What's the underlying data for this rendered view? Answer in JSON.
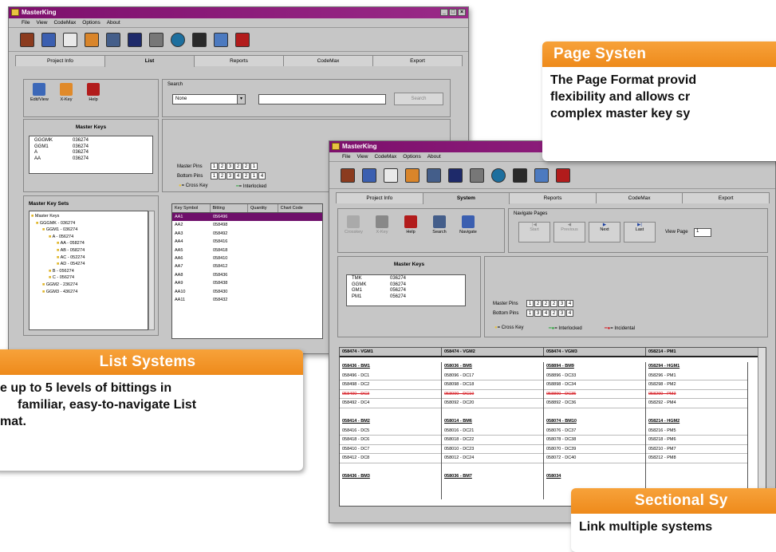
{
  "win1": {
    "title": "MasterKing",
    "menu": [
      "File",
      "View",
      "CodeMax",
      "Options",
      "About"
    ],
    "tabs": [
      "Project Info",
      "List",
      "Reports",
      "CodeMax",
      "Export"
    ],
    "active_tab": "List",
    "tools": [
      "Edit/View",
      "X-Key",
      "Help"
    ],
    "search_label": "Search",
    "search_select": "None",
    "search_button": "Search",
    "master_keys_title": "Master Keys",
    "master_keys": [
      [
        "GGGMK",
        "036274"
      ],
      [
        "GGM1",
        "036274"
      ],
      [
        "A",
        "036274"
      ],
      [
        "AA",
        "036274"
      ]
    ],
    "master_pins_label": "Master Pins",
    "master_pins": [
      "1",
      "2",
      "3",
      "2",
      "2",
      "1"
    ],
    "bottom_pins_label": "Bottom Pins",
    "bottom_pins": [
      "1",
      "2",
      "3",
      "4",
      "2",
      "1",
      "4"
    ],
    "legend": [
      "= Cross Key",
      "= Interlocked",
      "= Incidental"
    ],
    "sets_title": "Master Key Sets",
    "tree": [
      "Master Keys",
      "GGGMK - 036274",
      "GGM1 - 036274",
      "A - 056274",
      "AA - 058274",
      "AB - 058274",
      "AC - 052274",
      "AD - 054274",
      "B - 056274",
      "C - 056274",
      "GGM2 - 236274",
      "GGM3 - 436274"
    ],
    "table_headers": [
      "Key Symbol",
      "Bitting",
      "Quantity",
      "Chart Code"
    ],
    "table_rows": [
      [
        "AA1",
        "056496"
      ],
      [
        "AA2",
        "058498"
      ],
      [
        "AA3",
        "058492"
      ],
      [
        "AA4",
        "058416"
      ],
      [
        "AA5",
        "058418"
      ],
      [
        "AA6",
        "058410"
      ],
      [
        "AA7",
        "058412"
      ],
      [
        "AA8",
        "058436"
      ],
      [
        "AA9",
        "058438"
      ],
      [
        "AA10",
        "058430"
      ],
      [
        "AA11",
        "058432"
      ]
    ]
  },
  "win2": {
    "title": "MasterKing",
    "menu": [
      "File",
      "View",
      "CodeMax",
      "Options",
      "About"
    ],
    "tabs": [
      "Project Info",
      "System",
      "Reports",
      "CodeMax",
      "Export"
    ],
    "active_tab": "System",
    "tools": [
      "Crosskey",
      "X-Key",
      "Help",
      "Search",
      "Navigate"
    ],
    "nav_title": "Navigate Pages",
    "nav_buttons": [
      "Start",
      "Previous",
      "Next",
      "Last"
    ],
    "view_page_label": "View Page",
    "view_page_value": "1",
    "master_keys_title": "Master Keys",
    "master_keys": [
      [
        "TMK",
        "036274"
      ],
      [
        "GGMK",
        "036274"
      ],
      [
        "GM1",
        "056274"
      ],
      [
        "PM1",
        "056274"
      ]
    ],
    "master_pins_label": "Master Pins",
    "master_pins": [
      "1",
      "2",
      "2",
      "2",
      "3",
      "4"
    ],
    "bottom_pins_label": "Bottom Pins",
    "bottom_pins": [
      "1",
      "3",
      "4",
      "2",
      "3",
      "4"
    ],
    "legend": [
      "= Cross Key",
      "= Interlocked",
      "= Incidental"
    ],
    "grid_headers": [
      "058474 - VGM1",
      "058474 - VGM2",
      "058474 - VGM3",
      "058214 - PM1"
    ],
    "grid_cols": [
      [
        {
          "t": "058436 - BM1",
          "h": true
        },
        {
          "t": "058496 - DC1"
        },
        {
          "t": "058498 - DC2"
        },
        {
          "t": "058490 - DC3",
          "s": true
        },
        {
          "t": "058492 - DC4"
        },
        {
          "t": ""
        },
        {
          "t": "058414 - BM2",
          "h": true
        },
        {
          "t": "058416 - DC5"
        },
        {
          "t": "058418 - DC6"
        },
        {
          "t": "058410 - DC7"
        },
        {
          "t": "058412 - DC8"
        },
        {
          "t": ""
        },
        {
          "t": "058436 - BM3",
          "h": true
        }
      ],
      [
        {
          "t": "058036 - BM5",
          "h": true
        },
        {
          "t": "058096 - DC17"
        },
        {
          "t": "058098 - DC18"
        },
        {
          "t": "058090 - DC19",
          "s": true
        },
        {
          "t": "058092 - DC20"
        },
        {
          "t": ""
        },
        {
          "t": "058014 - BM6",
          "h": true
        },
        {
          "t": "058016 - DC21"
        },
        {
          "t": "058018 - DC22"
        },
        {
          "t": "058010 - DC23"
        },
        {
          "t": "058012 - DC24"
        },
        {
          "t": ""
        },
        {
          "t": "058036 - BM7",
          "h": true
        }
      ],
      [
        {
          "t": "058894 - BM9",
          "h": true
        },
        {
          "t": "058896 - DC33"
        },
        {
          "t": "058898 - DC34"
        },
        {
          "t": "058890 - DC35",
          "s": true
        },
        {
          "t": "058892 - DC36"
        },
        {
          "t": ""
        },
        {
          "t": "058074 - BM10",
          "h": true
        },
        {
          "t": "058076 - DC37"
        },
        {
          "t": "058078 - DC38"
        },
        {
          "t": "058070 - DC39"
        },
        {
          "t": "058072 - DC40"
        },
        {
          "t": ""
        },
        {
          "t": "058034",
          "h": true
        }
      ],
      [
        {
          "t": "058294 - HGM1",
          "h": true
        },
        {
          "t": "058296 - PM1"
        },
        {
          "t": "058298 - PM2"
        },
        {
          "t": "058290 - PM3",
          "s": true
        },
        {
          "t": "058292 - PM4"
        },
        {
          "t": ""
        },
        {
          "t": "058214 - HGM2",
          "h": true
        },
        {
          "t": "058216 - PM5"
        },
        {
          "t": "058218 - PM6"
        },
        {
          "t": "058210 - PM7"
        },
        {
          "t": "058212 - PM8"
        }
      ]
    ]
  },
  "callouts": {
    "page": {
      "title": "Page Systen",
      "body": [
        "The Page Format provid",
        "flexibility and allows cr",
        "complex master key sy"
      ]
    },
    "list": {
      "title": "List Systems",
      "body": [
        "e up to 5 levels of bittings in",
        "familiar, easy-to-navigate List",
        "mat."
      ]
    },
    "sectional": {
      "title": "Sectional Sy",
      "body": [
        "Link multiple systems"
      ]
    }
  },
  "colors": {
    "titlebar": "#8b1a7a",
    "callout": "#f39a2e",
    "window": "#c6c6c6",
    "selected": "#6e0f6a",
    "incidental": "#d4141c",
    "interlocked": "#2aa63a",
    "crosskey": "#e8c340"
  }
}
